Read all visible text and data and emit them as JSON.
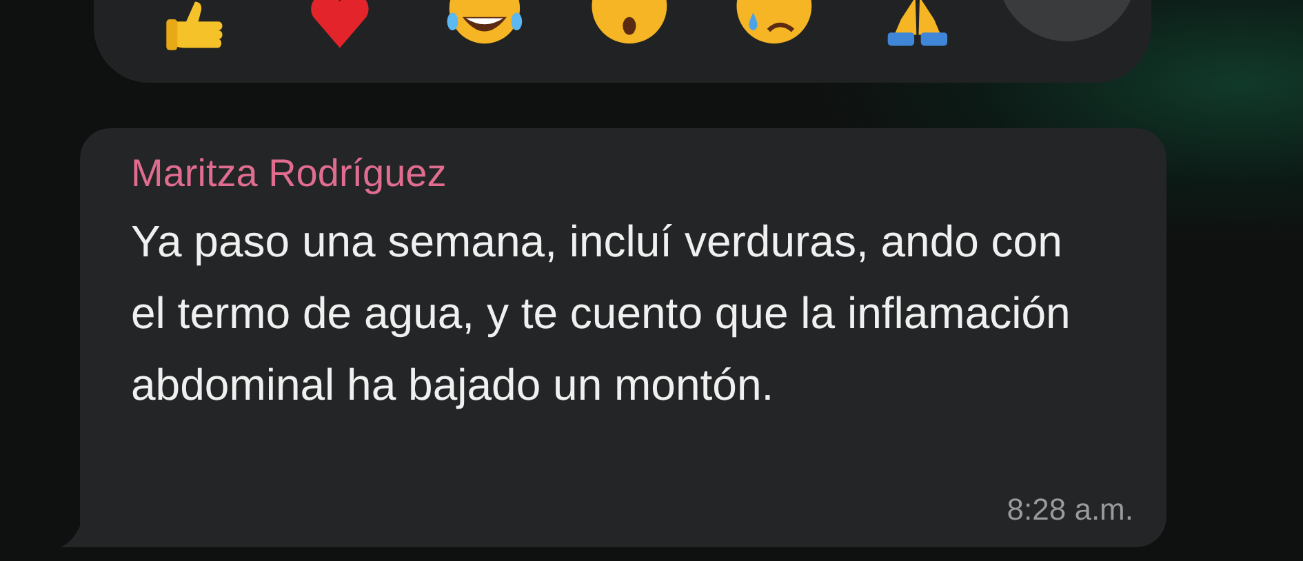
{
  "message": {
    "sender": "Maritza Rodríguez",
    "text": "Ya paso una semana, incluí verduras, ando con el termo de agua, y te cuento que la inflamación abdominal ha bajado un montón.",
    "time": "8:28 a.m."
  }
}
